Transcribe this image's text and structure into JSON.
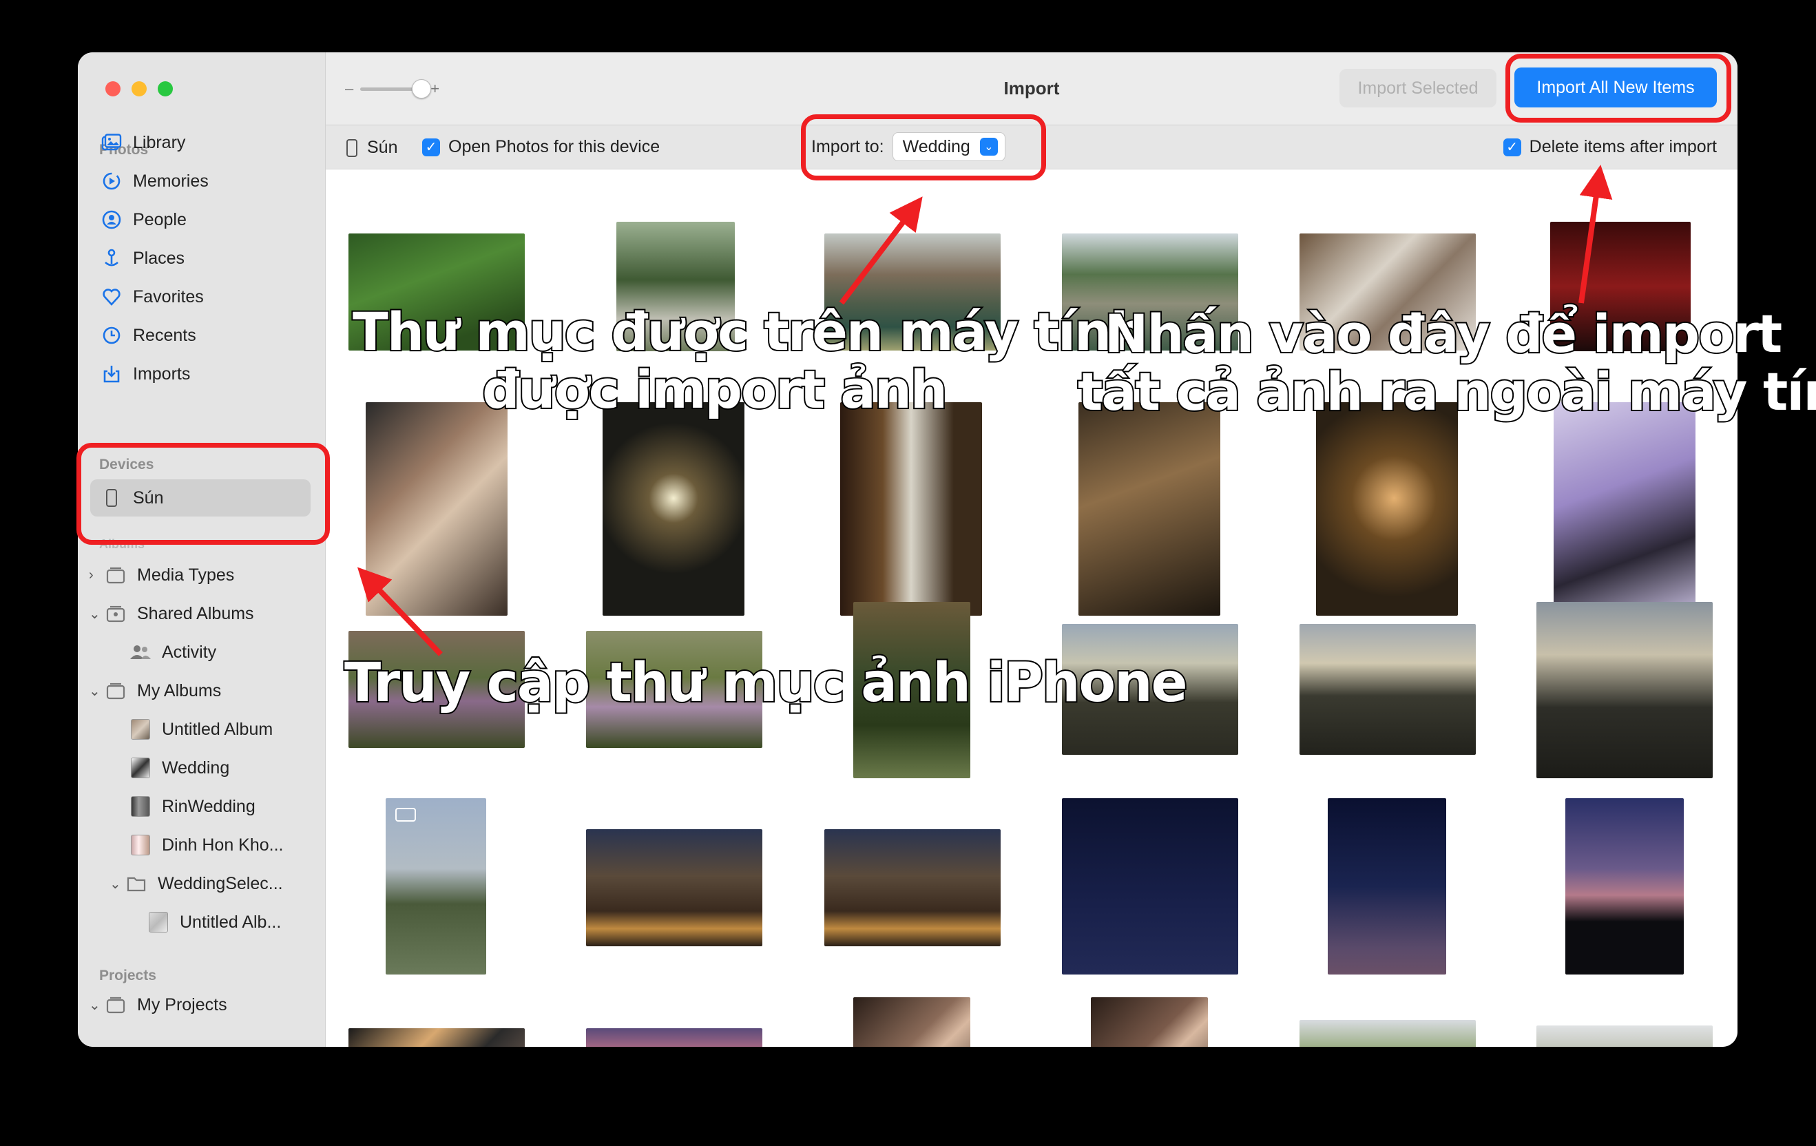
{
  "window": {
    "title": "Import"
  },
  "toolbar": {
    "zoom_minus": "–",
    "zoom_plus": "+",
    "import_selected": "Import Selected",
    "import_all": "Import All New Items"
  },
  "subbar": {
    "device_name": "Sún",
    "open_photos": "Open Photos for this device",
    "import_to_label": "Import to:",
    "import_to_value": "Wedding",
    "delete_after": "Delete items after import"
  },
  "sidebar": {
    "photos_header": "Photos",
    "photos_items": [
      {
        "label": "Library",
        "icon": "library-icon"
      },
      {
        "label": "Memories",
        "icon": "memories-icon"
      },
      {
        "label": "People",
        "icon": "people-icon"
      },
      {
        "label": "Places",
        "icon": "places-icon"
      },
      {
        "label": "Favorites",
        "icon": "heart-icon"
      },
      {
        "label": "Recents",
        "icon": "clock-icon"
      },
      {
        "label": "Imports",
        "icon": "import-icon"
      }
    ],
    "devices_header": "Devices",
    "device_item": "Sún",
    "albums_header": "Albums",
    "album_items": [
      {
        "label": "Media Types"
      },
      {
        "label": "Shared Albums"
      },
      {
        "label": "Activity"
      },
      {
        "label": "My Albums"
      },
      {
        "label": "Untitled Album"
      },
      {
        "label": "Wedding"
      },
      {
        "label": "RinWedding"
      },
      {
        "label": "Dinh Hon Kho..."
      },
      {
        "label": "WeddingSelec..."
      },
      {
        "label": "Untitled Alb..."
      }
    ],
    "projects_header": "Projects",
    "projects_items": [
      {
        "label": "My Projects"
      }
    ]
  },
  "annotations": {
    "folder_line1": "Thư mục được trên máy tính",
    "folder_line2": "được import ảnh",
    "import_line1": "Nhấn vào đây để import",
    "import_line2": "tất cả ảnh ra ngoài máy tính",
    "access": "Truy cập thư mục ảnh iPhone"
  },
  "colors": {
    "accent": "#1a82fb",
    "annotation_red": "#ef1f22",
    "sidebar_bg": "#e4e4e4"
  }
}
